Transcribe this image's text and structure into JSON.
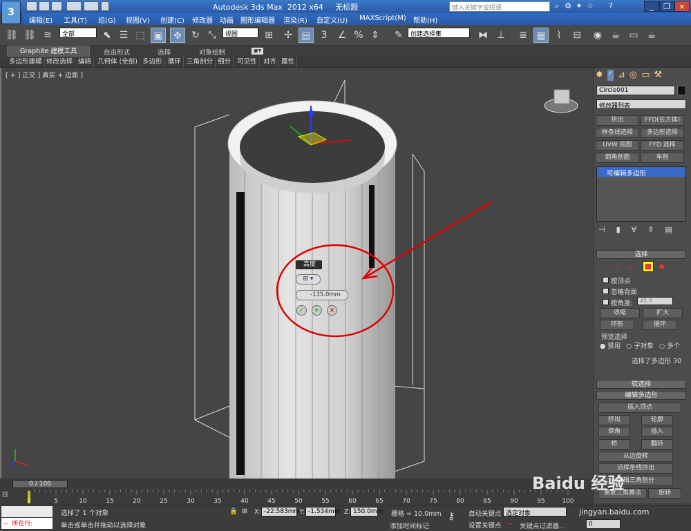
{
  "app": {
    "icon_text": "3",
    "title": "Autodesk 3ds Max  2012 x64     无标题",
    "search_placeholder": "键入关键字或短语"
  },
  "menu": [
    "编辑(E)",
    "工具(T)",
    "组(G)",
    "视图(V)",
    "创建(C)",
    "修改器",
    "动画",
    "图形编辑器",
    "渲染(R)",
    "自定义(U)",
    "MAXScript(M)",
    "帮助(H)"
  ],
  "toolbar": {
    "filter": "全部",
    "coord": "视图",
    "named_sel": "创建选择集"
  },
  "ribbon": {
    "tabs": [
      "Graphite 建模工具",
      "自由形式",
      "选择",
      "对象绘制"
    ],
    "subtabs": [
      "多边形建模",
      "修改选择",
      "编辑",
      "几何体 (全部)",
      "多边形",
      "循环",
      "三角剖分",
      "细分",
      "可见性",
      "对齐",
      "属性"
    ]
  },
  "viewport": {
    "label": "[ + ] 正交 ] 真实 + 边面 ]"
  },
  "caddy": {
    "title": "高度",
    "value": "-135.0mm",
    "ok": "✓",
    "add": "+",
    "cancel": "×"
  },
  "panel": {
    "object_name": "Circle001",
    "modifier_list": "修改器列表",
    "mod_buttons": [
      "挤出",
      "FFD(长方体)",
      "样条线选择",
      "多边形选择",
      "UVW 贴图",
      "FFD 选择",
      "倒角剖面",
      "车削"
    ],
    "stack_item": "可编辑多边形",
    "selection_title": "选择",
    "sel_checks": [
      "按顶点",
      "忽略背面",
      "按角度:"
    ],
    "angle_value": "45.0",
    "shrink": "收缩",
    "grow": "扩大",
    "ring": "环形",
    "loop": "循环",
    "preview_title": "预览选择",
    "preview_opts": [
      "禁用",
      "子对象",
      "多个"
    ],
    "sel_info": "选择了多边形 30",
    "soft_sel": "软选择",
    "edit_poly": "编辑多边形",
    "insert_vertex": "插入顶点",
    "edit_buttons": [
      "挤出",
      "轮廓",
      "倒角",
      "插入",
      "桥",
      "翻转"
    ],
    "hinge": "从边旋转",
    "extrude_spline": "沿样条线挤出",
    "edit_tri": "编辑三角剖分",
    "retri": "重复三角算法",
    "turn": "旋转"
  },
  "timeline": {
    "frame": "0 / 100",
    "ticks": [
      "0",
      "5",
      "10",
      "15",
      "20",
      "25",
      "30",
      "35",
      "40",
      "45",
      "50",
      "55",
      "60",
      "65",
      "70",
      "75",
      "80",
      "85",
      "90",
      "95",
      "100"
    ]
  },
  "status": {
    "running": "所在行:",
    "selected": "选择了 1 个对象",
    "prompt": "单击或单击并拖动以选择对象",
    "x_label": "X:",
    "x": "-22.583mm",
    "y_label": "Y:",
    "y": "-1.534mm",
    "z_label": "Z:",
    "z": "150.0mm",
    "grid": "栅格 = 10.0mm",
    "add_tag": "添加时间标记",
    "autokey": "自动关键点",
    "setkey": "设置关键点",
    "sel_obj": "选定对象",
    "key_filter": "关键点过滤器...",
    "frame_val": "0"
  },
  "watermark": {
    "text": "Baidu 经验",
    "sub": "jingyan.baidu.com"
  },
  "colors": {
    "accent": "#e00000",
    "selection_blue": "#3a6ac8"
  }
}
